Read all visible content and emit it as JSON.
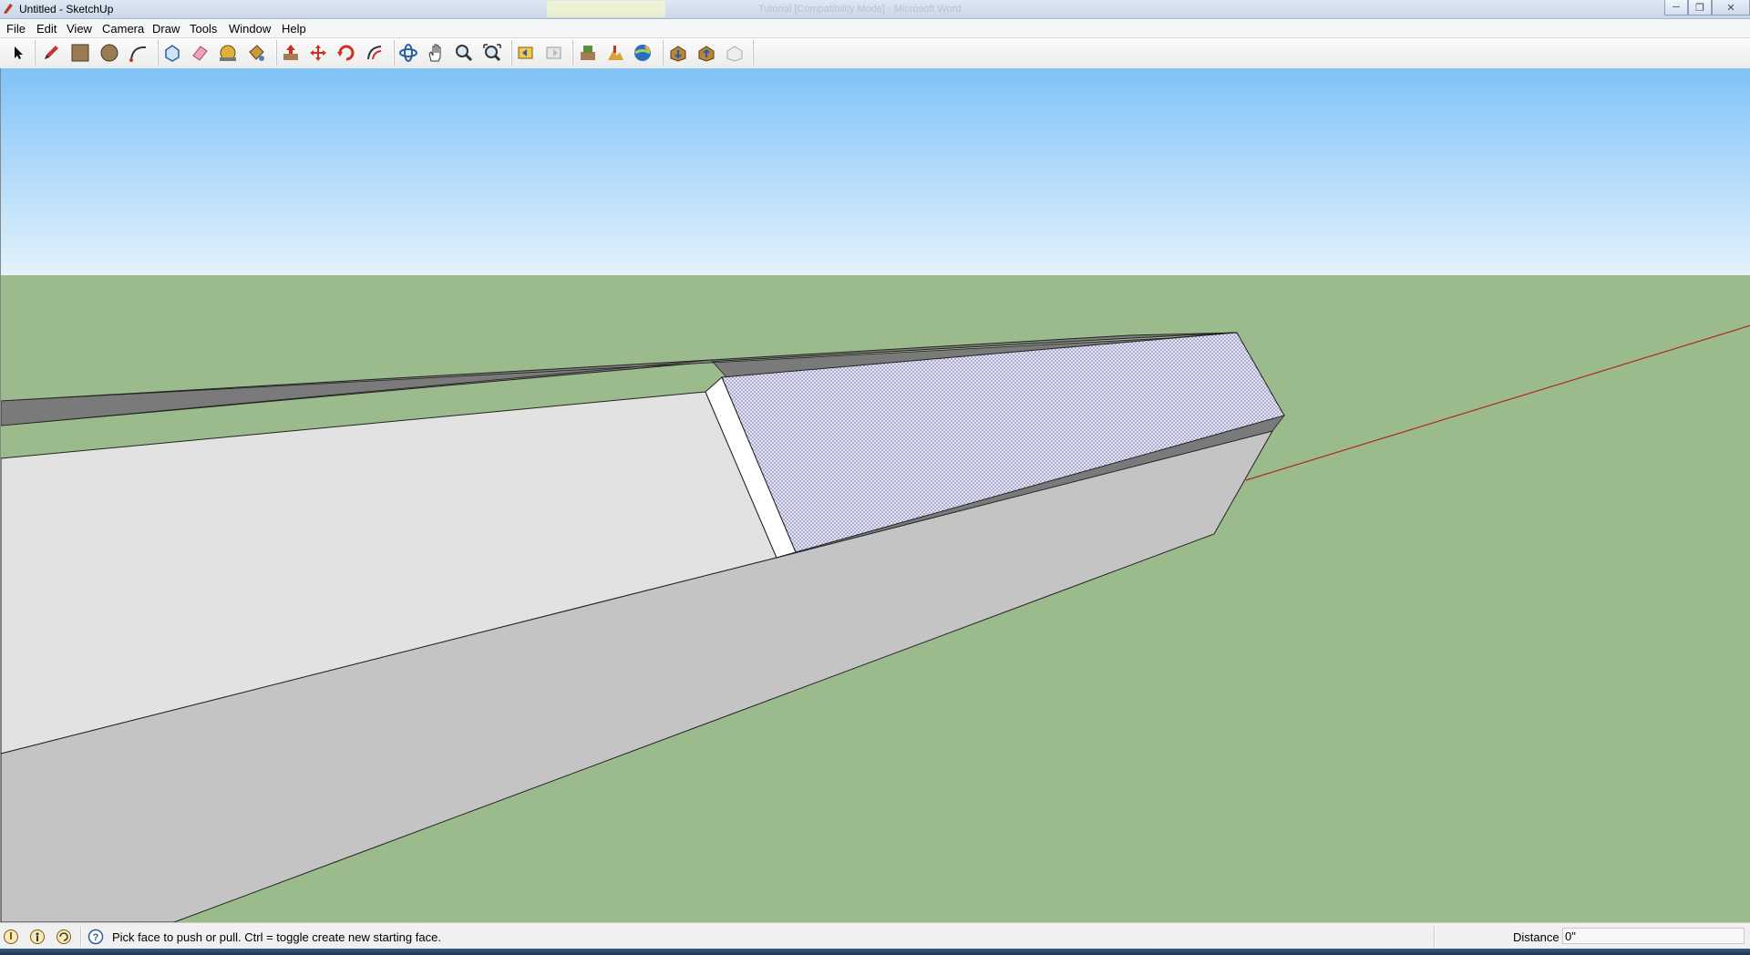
{
  "window": {
    "title": "Untitled - SketchUp",
    "background_title": "Tutorial [Compatibility Mode] - Microsoft Word",
    "controls": [
      "minimize-icon",
      "restore-icon",
      "close-icon"
    ]
  },
  "menu": {
    "items": [
      "File",
      "Edit",
      "View",
      "Camera",
      "Draw",
      "Tools",
      "Window",
      "Help"
    ]
  },
  "toolbar": {
    "tools": [
      "select-icon",
      "pencil-icon",
      "rectangle-icon",
      "circle-icon",
      "arc-icon",
      "make-component-icon",
      "eraser-icon",
      "tape-measure-icon",
      "paint-bucket-icon",
      "push-pull-icon",
      "move-icon",
      "rotate-icon",
      "offset-icon",
      "orbit-icon",
      "pan-icon",
      "zoom-icon",
      "zoom-extents-icon",
      "previous-view-icon",
      "next-view-icon",
      "get-current-view-icon",
      "toggle-terrain-icon",
      "place-model-icon",
      "get-models-icon",
      "share-model-icon",
      "share-component-icon"
    ]
  },
  "viewport": {
    "sky_color_top": "#7fc3f7",
    "sky_color_bottom": "#e4f2fb",
    "ground_color": "#9bbb8c",
    "axis_color": "#b0262a",
    "selected_face_pattern": "dotted-blue"
  },
  "status": {
    "icons": [
      "geo-location-icon",
      "credits-icon",
      "sign-in-icon",
      "help-icon"
    ],
    "message": "Pick face to push or pull.  Ctrl = toggle create new starting face.",
    "measurement_label": "Distance",
    "measurement_value": "0\""
  }
}
